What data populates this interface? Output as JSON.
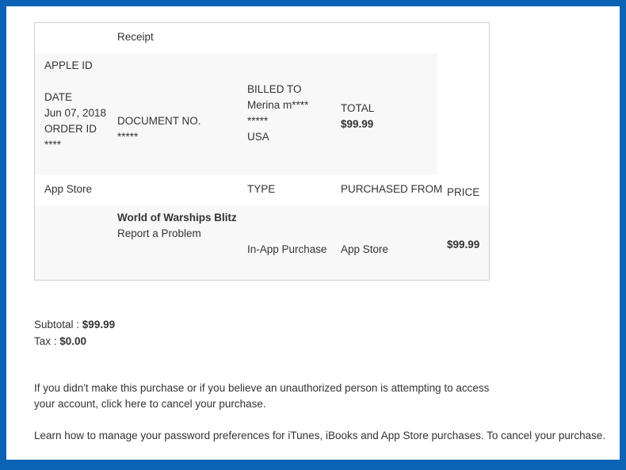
{
  "receipt": {
    "title": "Receipt",
    "apple_id_label": "APPLE ID",
    "date_label": "DATE",
    "date_value": "Jun 07, 2018",
    "order_id_label": "ORDER ID",
    "order_id_value": "****",
    "document_no_label": "DOCUMENT NO.",
    "document_no_value": "*****",
    "billed_to_label": "BILLED TO",
    "billed_to_name": "Merina m****",
    "billed_to_line2": "*****",
    "billed_to_country": "USA",
    "total_label": "TOTAL",
    "total_value": "$99.99"
  },
  "items_header": {
    "store": "App Store",
    "type": "TYPE",
    "purchased_from": "PURCHASED FROM",
    "price": "PRICE"
  },
  "item": {
    "name": "World of Warships Blitz",
    "report_link": "Report a Problem",
    "type": "In-App Purchase",
    "purchased_from": "App Store",
    "price": "$99.99"
  },
  "summary": {
    "subtotal_label": "Subtotal : ",
    "subtotal_value": "$99.99",
    "tax_label": "Tax : ",
    "tax_value": "$0.00"
  },
  "footer": {
    "para1_line1": "If you didn't make this purchase or if you believe an unauthorized person is attempting to access",
    "para1_line2": "your account, click here to cancel your purchase.",
    "para2": "Learn how to manage your password preferences for iTunes, iBooks and App Store purchases. To cancel your purchase."
  },
  "colors": {
    "border_blue": "#0b63b5",
    "shade": "#f8f8f8",
    "text": "#333333"
  }
}
